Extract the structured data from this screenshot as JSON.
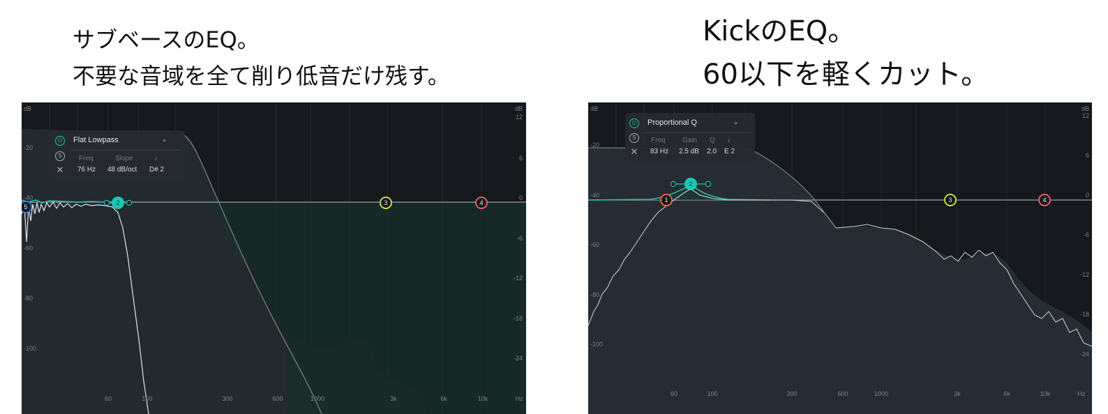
{
  "captions": {
    "left_line1": "サブベースのEQ。",
    "left_line2": "不要な音域を全て削り低音だけ残す。",
    "right_line1": "KickのEQ。",
    "right_line2": "60以下を軽くカット。"
  },
  "left_eq": {
    "panel": {
      "filter_type": "Flat Lowpass",
      "headers": [
        "Freq",
        "Slope",
        "♪"
      ],
      "values": [
        "76 Hz",
        "48 dB/oct",
        "D# 2"
      ],
      "icons": [
        "power-icon",
        "solo-icon",
        "close-icon",
        "chevron-down-icon",
        "play-arrow-icon"
      ]
    },
    "db_left_labels": [
      "dB",
      "-20",
      "-40",
      "-60",
      "-80",
      "-100"
    ],
    "db_right_labels": [
      "dB",
      "12",
      "6",
      "0",
      "-6",
      "-12",
      "-18",
      "-24"
    ],
    "freq_labels": [
      "60",
      "100",
      "300",
      "600",
      "1000",
      "3k",
      "6k",
      "10k",
      "Hz"
    ],
    "nodes": [
      {
        "label": "5",
        "color": "#3c6fd1"
      },
      {
        "label": "2",
        "color": "#1dc6b2"
      },
      {
        "label": "3",
        "color": "#c7d94a"
      },
      {
        "label": "4",
        "color": "#e0606a"
      }
    ]
  },
  "right_eq": {
    "panel": {
      "filter_type": "Proportional Q",
      "headers": [
        "Freq",
        "Gain",
        "Q",
        "♪"
      ],
      "values": [
        "83 Hz",
        "2.5 dB",
        "2.0",
        "E 2"
      ],
      "icons": [
        "power-icon",
        "solo-icon",
        "close-icon",
        "chevron-down-icon",
        "play-arrow-icon"
      ]
    },
    "db_left_labels": [
      "dB",
      "-20",
      "-40",
      "-60",
      "-80",
      "-100"
    ],
    "db_right_labels": [
      "dB",
      "12",
      "6",
      "0",
      "-6",
      "-12",
      "-18",
      "-24"
    ],
    "freq_labels": [
      "60",
      "100",
      "300",
      "600",
      "1000",
      "3k",
      "6k",
      "10k",
      "Hz"
    ],
    "nodes": [
      {
        "label": "1",
        "color": "#e8673a"
      },
      {
        "label": "2",
        "color": "#1dc6b2"
      },
      {
        "label": "3",
        "color": "#c7d94a"
      },
      {
        "label": "4",
        "color": "#e0606a"
      }
    ]
  }
}
